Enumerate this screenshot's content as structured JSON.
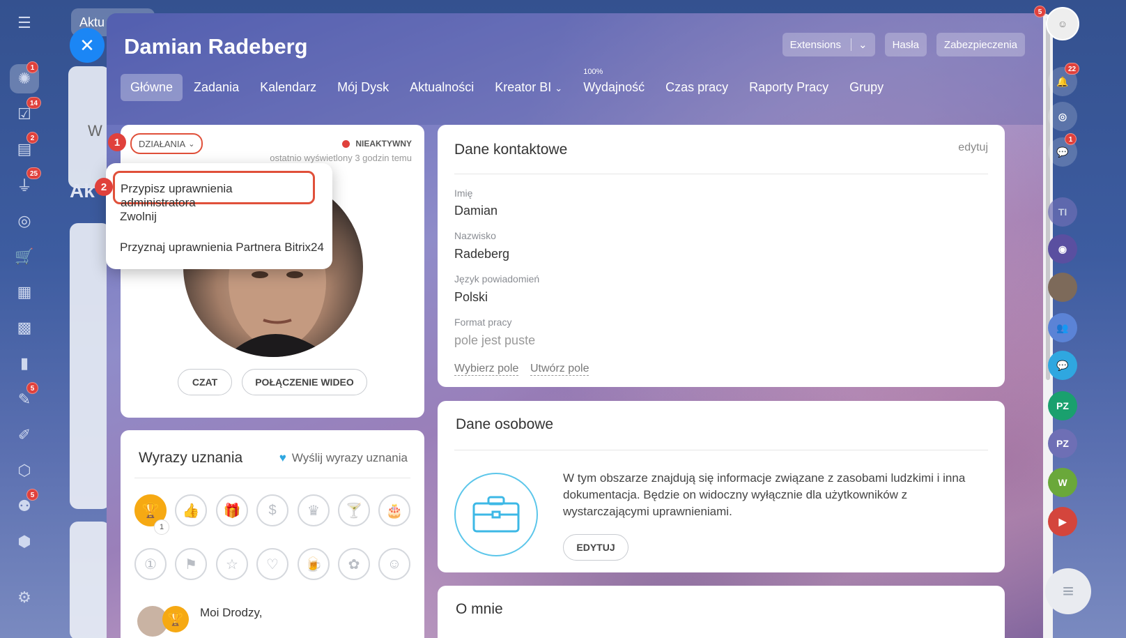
{
  "behind": {
    "tab_text": "Aktu",
    "heading": "Ak",
    "letter": "W"
  },
  "left_sidebar": {
    "badges": [
      "1",
      "14",
      "2",
      "25",
      "5",
      "5"
    ]
  },
  "header": {
    "name": "Damian Radeberg",
    "buttons": {
      "extensions": "Extensions",
      "passwords": "Hasła",
      "security": "Zabezpieczenia"
    }
  },
  "tabs": [
    "Główne",
    "Zadania",
    "Kalendarz",
    "Mój Dysk",
    "Aktualności",
    "Kreator BI",
    "Wydajność",
    "Czas pracy",
    "Raporty Pracy",
    "Grupy"
  ],
  "tabs_extra": {
    "performance_percent": "100%"
  },
  "profile": {
    "actions_label": "DZIAŁANIA",
    "status": "NIEAKTYWNY",
    "last_seen": "ostatnio wyświetlony 3 godzin temu",
    "chat_button": "CZAT",
    "video_button": "POŁĄCZENIE WIDEO",
    "step1": "1",
    "step2": "2"
  },
  "actions_menu": {
    "items": [
      "Przypisz uprawnienia administratora",
      "Zwolnij",
      "Przyznaj uprawnienia Partnera Bitrix24"
    ]
  },
  "kudos": {
    "title": "Wyrazy uznania",
    "send": "Wyślij wyrazy uznania",
    "trophy_count": "1",
    "feed_text": "Moi Drodzy,"
  },
  "contact": {
    "title": "Dane kontaktowe",
    "edit": "edytuj",
    "fields": [
      {
        "label": "Imię",
        "value": "Damian"
      },
      {
        "label": "Nazwisko",
        "value": "Radeberg"
      },
      {
        "label": "Język powiadomień",
        "value": "Polski"
      },
      {
        "label": "Format pracy",
        "value": "pole jest puste"
      }
    ],
    "select_field": "Wybierz pole",
    "create_field": "Utwórz pole"
  },
  "personal": {
    "title": "Dane osobowe",
    "text": "W tym obszarze znajdują się informacje związane z zasobami ludzkimi i inna dokumentacja. Będzie on widoczny wyłącznie dla użytkowników z wystarczającymi uprawnieniami.",
    "edit_button": "EDYTUJ"
  },
  "about": {
    "title": "O mnie"
  },
  "right_sidebar": {
    "notif_badge": "22",
    "chat_badge": "1",
    "corner_badge": "5",
    "initials": [
      "TI",
      "PZ",
      "PZ",
      "W"
    ]
  },
  "colors": {
    "accent": "#1b86f5",
    "highlight": "#e0503a",
    "badge": "#e0413c",
    "gold": "#f6a913"
  }
}
